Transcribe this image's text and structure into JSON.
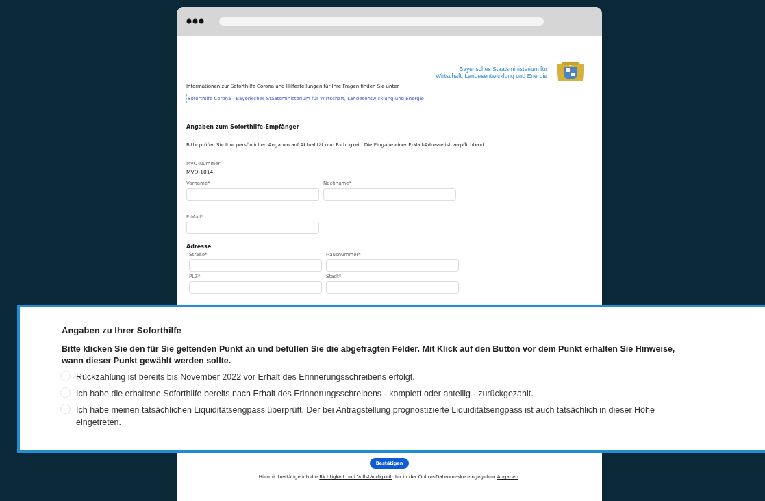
{
  "ministry": {
    "lines": [
      "Bayerisches Staatsministerium für",
      "Wirtschaft, Landesentwicklung und Energie"
    ]
  },
  "info": {
    "text": "Informationen zur Soforthilfe Corona und Hilfestellungen für Ihre Fragen finden Sie unter",
    "link": "Soforthilfe Corona - Bayerisches Staatsministerium für Wirtschaft, Landesentwicklung und Energie"
  },
  "recipient": {
    "heading": "Angaben zum Soforthilfe-Empfänger",
    "intro": "Bitte prüfen Sie Ihre persönlichen Angaben auf Aktualität und Richtigkeit. Die Eingabe einer E-Mail-Adresse ist verpflichtend.",
    "mvo_label": "MVO-Nummer",
    "mvo_value": "MVO-1014"
  },
  "name_fields": [
    {
      "label": "Vorname*"
    },
    {
      "label": "Nachname*"
    }
  ],
  "email_field": {
    "label": "E-Mail*"
  },
  "address": {
    "heading": "Adresse",
    "rows": [
      [
        {
          "label": "Straße*"
        },
        {
          "label": "Hausnummer*"
        }
      ],
      [
        {
          "label": "PLZ*"
        },
        {
          "label": "Stadt*"
        }
      ]
    ]
  },
  "aid": {
    "heading": "Angaben zu Ihrer Soforthilfe",
    "instruction": "Bitte klicken Sie den für Sie geltenden Punkt an und befüllen Sie die abgefragten Felder. Mit Klick auf den Button vor dem Punkt erhalten Sie Hinweise, wann dieser Punkt gewählt werden sollte.",
    "options": [
      {
        "label": "Rückzahlung ist bereits bis November 2022 vor Erhalt des Erinnerungsschreibens erfolgt.",
        "selected": false
      },
      {
        "label": "Ich habe die erhaltene Soforthilfe bereits nach Erhalt des Erinnerungsschreibens - komplett oder anteilig - zurückgezahlt.",
        "selected": false
      },
      {
        "label": "Ich habe meinen tatsächlichen Liquiditätsengpass überprüft. Der bei Antragstellung prognostizierte Liquiditätsengpass ist auch tatsächlich in dieser Höhe eingetreten.",
        "selected": false
      }
    ]
  },
  "confirm_button": "Bestätigen",
  "confirmation": [
    {
      "kind": "text",
      "text": "Hiermit bestätige ich die "
    },
    {
      "kind": "link",
      "text": "Richtigkeit und Vollständigkeit"
    },
    {
      "kind": "text",
      "text": " der in der Online-Datenmaske eingegeben "
    },
    {
      "kind": "link",
      "text": "Angaben"
    },
    {
      "kind": "text",
      "text": "."
    }
  ]
}
